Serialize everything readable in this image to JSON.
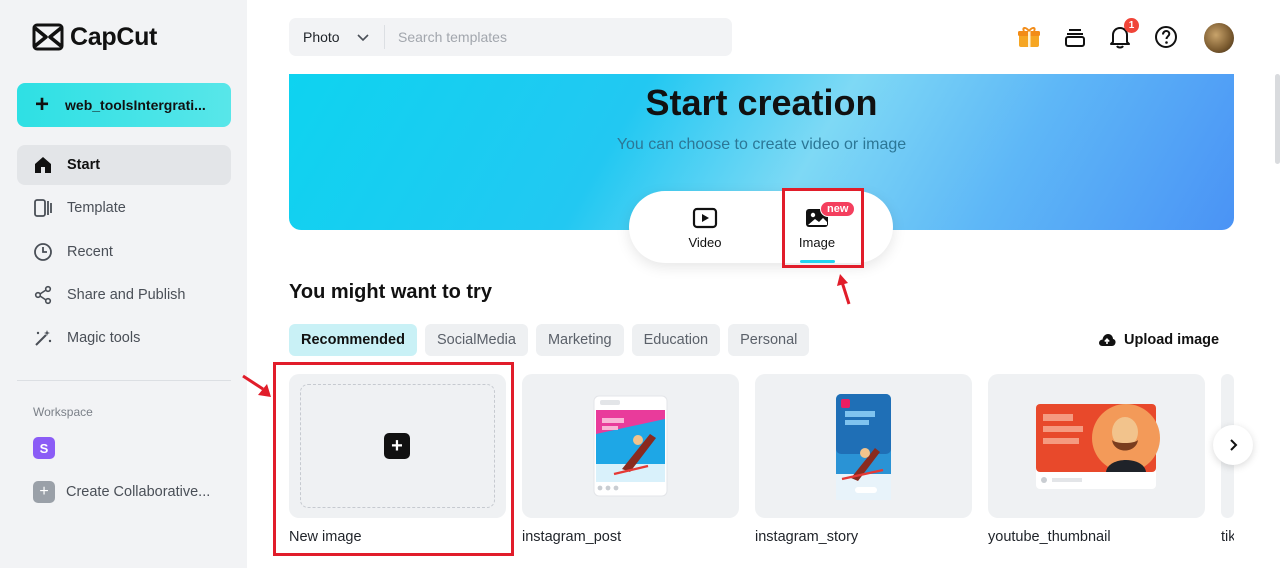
{
  "app": {
    "logo_text": "CapCut"
  },
  "sidebar": {
    "create_label": "web_toolsIntergrati...",
    "items": [
      {
        "label": "Start",
        "icon": "home-icon",
        "active": true
      },
      {
        "label": "Template",
        "icon": "template-icon"
      },
      {
        "label": "Recent",
        "icon": "clock-icon"
      },
      {
        "label": "Share and Publish",
        "icon": "share-icon"
      },
      {
        "label": "Magic tools",
        "icon": "magic-wand-icon"
      }
    ],
    "workspace_label": "Workspace",
    "workspace_initial": "S",
    "collab_label": "Create Collaborative..."
  },
  "topbar": {
    "select_value": "Photo",
    "search_placeholder": "Search templates",
    "notification_count": "1"
  },
  "hero": {
    "title": "Start creation",
    "subtitle": "You can choose to create video or image",
    "video_label": "Video",
    "image_label": "Image",
    "new_badge": "new"
  },
  "section": {
    "title": "You might want to try",
    "chips": [
      "Recommended",
      "SocialMedia",
      "Marketing",
      "Education",
      "Personal"
    ],
    "upload_label": "Upload image"
  },
  "cards": [
    {
      "label": "New image"
    },
    {
      "label": "instagram_post"
    },
    {
      "label": "instagram_story"
    },
    {
      "label": "youtube_thumbnail"
    },
    {
      "label": "tik"
    }
  ],
  "colors": {
    "accent": "#22d3ee",
    "highlight": "#e11d2a",
    "badge": "#f04438"
  }
}
